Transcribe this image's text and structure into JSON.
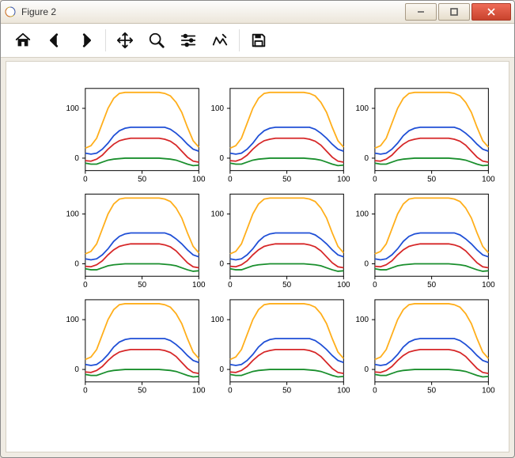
{
  "window": {
    "title": "Figure 2"
  },
  "toolbar": {
    "buttons": [
      "home",
      "back",
      "forward",
      "|",
      "pan",
      "zoom",
      "configure",
      "edit",
      "|",
      "save"
    ]
  },
  "chart_data": {
    "type": "line",
    "grid_layout": [
      3,
      3
    ],
    "xlim": [
      0,
      100
    ],
    "ylim": [
      -25,
      140
    ],
    "xticks": [
      0,
      50,
      100
    ],
    "yticks": [
      0,
      100
    ],
    "x": [
      0,
      5,
      10,
      15,
      20,
      25,
      30,
      35,
      40,
      45,
      50,
      55,
      60,
      65,
      70,
      75,
      80,
      85,
      90,
      95,
      100
    ],
    "series": [
      {
        "name": "blue",
        "color": "#1f4fd6",
        "values": [
          10,
          8,
          10,
          18,
          30,
          45,
          55,
          60,
          62,
          62,
          62,
          62,
          62,
          62,
          62,
          58,
          50,
          40,
          28,
          18,
          14
        ]
      },
      {
        "name": "orange",
        "color": "#ffae1a",
        "values": [
          20,
          25,
          40,
          70,
          100,
          120,
          130,
          132,
          132,
          132,
          132,
          132,
          132,
          132,
          130,
          125,
          112,
          92,
          62,
          35,
          22
        ]
      },
      {
        "name": "green",
        "color": "#1a8f2d",
        "values": [
          -10,
          -12,
          -12,
          -8,
          -4,
          -2,
          -1,
          0,
          0,
          0,
          0,
          0,
          0,
          0,
          -1,
          -2,
          -4,
          -8,
          -12,
          -15,
          -14
        ]
      },
      {
        "name": "red",
        "color": "#d62728",
        "values": [
          -5,
          -6,
          -2,
          6,
          18,
          28,
          35,
          38,
          40,
          40,
          40,
          40,
          40,
          40,
          38,
          34,
          26,
          14,
          2,
          -6,
          -8
        ]
      }
    ],
    "panel_variation_note": "All nine panels show the same four curves with very similar shapes; minor jitter between panels is cosmetic only."
  }
}
